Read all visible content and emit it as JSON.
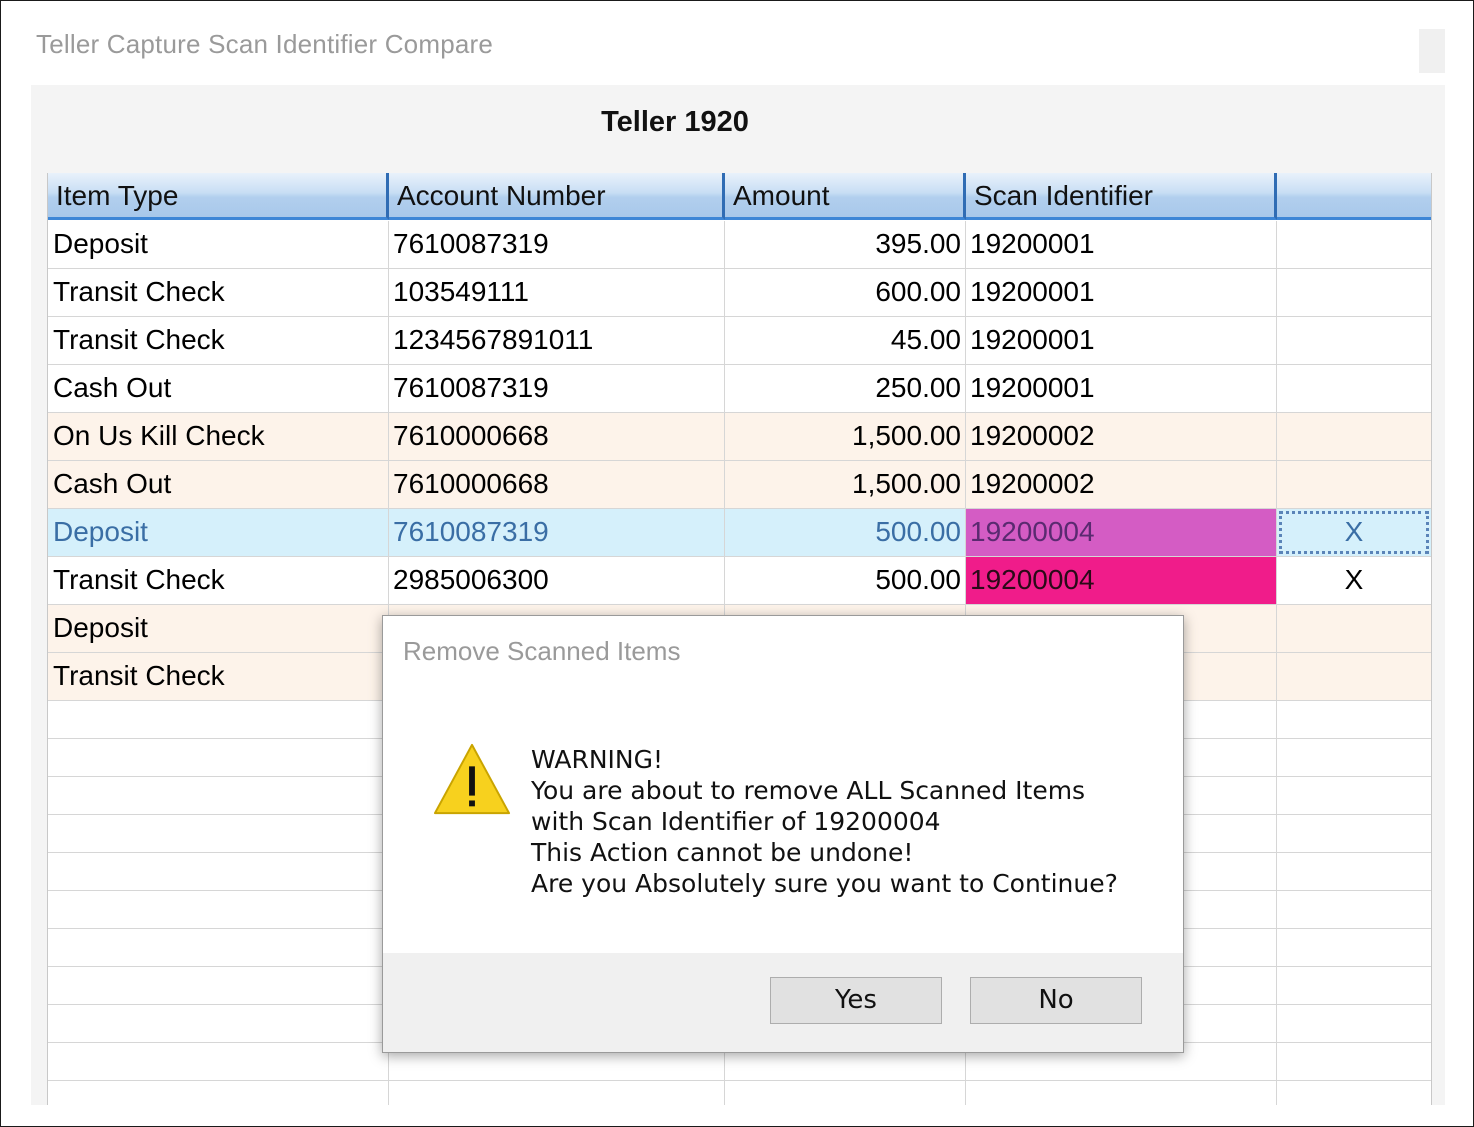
{
  "window": {
    "title": "Teller Capture Scan Identifier Compare"
  },
  "heading": "Teller 1920",
  "grid": {
    "columns": [
      "Item Type",
      "Account Number",
      "Amount",
      "Scan Identifier",
      ""
    ],
    "rows": [
      {
        "item_type": "Deposit",
        "account": "7610087319",
        "amount": "395.00",
        "scan_id": "19200001",
        "mark": "",
        "style": "white"
      },
      {
        "item_type": "Transit Check",
        "account": "103549111",
        "amount": "600.00",
        "scan_id": "19200001",
        "mark": "",
        "style": "white"
      },
      {
        "item_type": "Transit Check",
        "account": "1234567891011",
        "amount": "45.00",
        "scan_id": "19200001",
        "mark": "",
        "style": "white"
      },
      {
        "item_type": "Cash Out",
        "account": "7610087319",
        "amount": "250.00",
        "scan_id": "19200001",
        "mark": "",
        "style": "white"
      },
      {
        "item_type": "On Us Kill Check",
        "account": "7610000668",
        "amount": "1,500.00",
        "scan_id": "19200002",
        "mark": "",
        "style": "peach"
      },
      {
        "item_type": "Cash Out",
        "account": "7610000668",
        "amount": "1,500.00",
        "scan_id": "19200002",
        "mark": "",
        "style": "peach"
      },
      {
        "item_type": "Deposit",
        "account": "7610087319",
        "amount": "500.00",
        "scan_id": "19200004",
        "mark": "X",
        "style": "selected"
      },
      {
        "item_type": "Transit Check",
        "account": "2985006300",
        "amount": "500.00",
        "scan_id": "19200004",
        "mark": "X",
        "style": "pink"
      },
      {
        "item_type": "Deposit",
        "account": "",
        "amount": "",
        "scan_id": "",
        "mark": "",
        "style": "peach"
      },
      {
        "item_type": "Transit Check",
        "account": "",
        "amount": "",
        "scan_id": "",
        "mark": "",
        "style": "peach"
      }
    ],
    "highlight_colors": {
      "selected_scan": "#d45cc4",
      "duplicate_scan": "#f01c8a",
      "peach_row": "#fdf3ea",
      "selected_row": "#d5f0fb"
    }
  },
  "dialog": {
    "title": "Remove Scanned Items",
    "icon": "warning-icon",
    "message_lines": [
      "WARNING!",
      "You are about to remove ALL Scanned Items",
      "with Scan Identifier of 19200004",
      "This Action cannot be undone!",
      "Are you Absolutely sure you want to Continue?"
    ],
    "yes_label": "Yes",
    "no_label": "No"
  }
}
